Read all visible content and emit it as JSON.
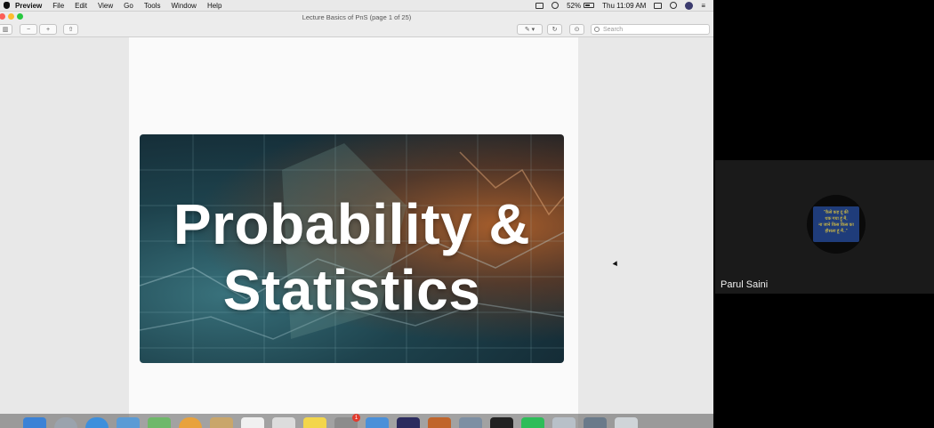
{
  "menubar": {
    "app": "Preview",
    "items": [
      "File",
      "Edit",
      "View",
      "Go",
      "Tools",
      "Window",
      "Help"
    ],
    "battery": "52%",
    "clock": "Thu 11:09 AM"
  },
  "window": {
    "title": "Lecture Basics of PnS (page 1 of 25)"
  },
  "toolbar": {
    "search_placeholder": "Search"
  },
  "slide": {
    "line1": "Probability &",
    "line2": "Statistics"
  },
  "participant": {
    "name": "Parul Saini",
    "avatar_text_1": "\"कैसे कह दूं की",
    "avatar_text_2": "थक गया हूं मैं,",
    "avatar_text_3": "ना जाने किस किस का",
    "avatar_text_4": "हौसला हूं मैं..\""
  },
  "dock": {
    "badge": "1"
  },
  "colors": {
    "close": "#fc5f57",
    "minimize": "#fdbc2e",
    "zoom": "#28c840",
    "meeting_bg": "#000000"
  }
}
